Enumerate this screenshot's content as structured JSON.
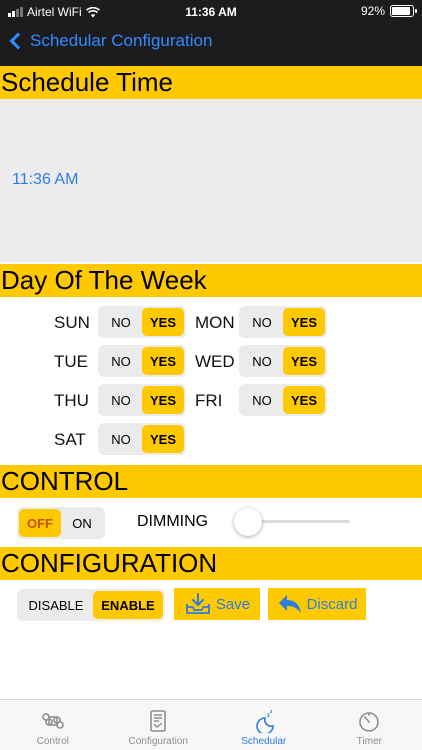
{
  "status_bar": {
    "carrier": "Airtel WiFi",
    "time": "11:36 AM",
    "battery": "92%",
    "battery_level": 0.92
  },
  "nav": {
    "back_label": "Schedular Configuration"
  },
  "schedule_time": {
    "header": "Schedule Time",
    "value": "11:36 AM"
  },
  "days": {
    "header": "Day Of The Week",
    "items": [
      {
        "label": "SUN",
        "no": "NO",
        "yes": "YES",
        "selected": "YES"
      },
      {
        "label": "MON",
        "no": "NO",
        "yes": "YES",
        "selected": "YES"
      },
      {
        "label": "TUE",
        "no": "NO",
        "yes": "YES",
        "selected": "YES"
      },
      {
        "label": "WED",
        "no": "NO",
        "yes": "YES",
        "selected": "YES"
      },
      {
        "label": "THU",
        "no": "NO",
        "yes": "YES",
        "selected": "YES"
      },
      {
        "label": "FRI",
        "no": "NO",
        "yes": "YES",
        "selected": "YES"
      },
      {
        "label": "SAT",
        "no": "NO",
        "yes": "YES",
        "selected": "YES"
      }
    ]
  },
  "control": {
    "header": "CONTROL",
    "off": "OFF",
    "on": "ON",
    "selected": "OFF",
    "dimming_label": "DIMMING",
    "dimming_value": 0.0
  },
  "configuration": {
    "header": "CONFIGURATION",
    "disable": "DISABLE",
    "enable": "ENABLE",
    "selected": "ENABLE",
    "save_label": "Save",
    "discard_label": "Discard"
  },
  "tabs": [
    {
      "label": "Control",
      "icon": "command-icon",
      "active": false
    },
    {
      "label": "Configuration",
      "icon": "document-icon",
      "active": false
    },
    {
      "label": "Schedular",
      "icon": "moon-sleep-icon",
      "active": true
    },
    {
      "label": "Timer",
      "icon": "timer-icon",
      "active": false
    }
  ],
  "colors": {
    "accent": "#ffc900",
    "link": "#2f7de0",
    "navbar": "#1c1c1e",
    "time_bg": "#ececee"
  }
}
